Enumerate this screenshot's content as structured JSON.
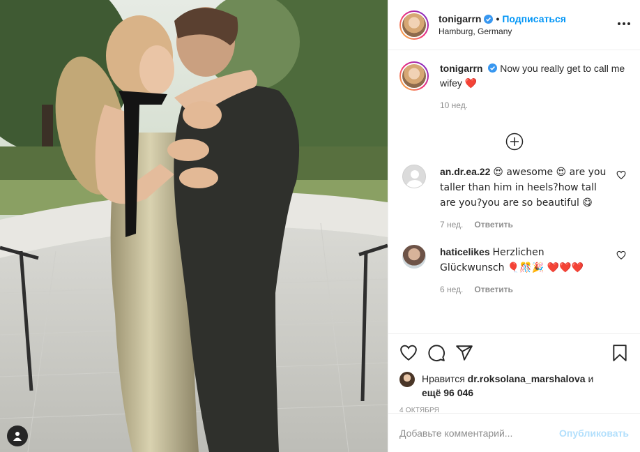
{
  "post": {
    "username": "tonigarrn",
    "follow_label": "Подписаться",
    "separator": "•",
    "location": "Hamburg, Germany",
    "more_icon": "more-horizontal-icon"
  },
  "caption": {
    "username": "tonigarrn",
    "text_line": "Now you really get to call me wifey",
    "emoji": "❤️",
    "age": "10 нед."
  },
  "load_more_icon": "plus-circle-icon",
  "comments": [
    {
      "username": "an.dr.ea.22",
      "text": "😍 awesome 😍 are you taller than him in heels?how tall are you?you are so beautiful 😋",
      "age": "7 нед.",
      "reply_label": "Ответить"
    },
    {
      "username": "haticelikes",
      "text": "Herzlichen Glückwunsch 🎈🎊🎉 ❤️❤️❤️",
      "age": "6 нед.",
      "reply_label": "Ответить"
    }
  ],
  "likes": {
    "prefix": "Нравится",
    "user": "dr.roksolana_marshalova",
    "and": "и",
    "more": "ещё 96 046"
  },
  "date": "4 ОКТЯБРЯ",
  "comment_box": {
    "placeholder": "Добавьте комментарий...",
    "publish_label": "Опубликовать"
  },
  "colors": {
    "accent": "#0095f6",
    "heart": "#ed4956",
    "muted": "#8e8e8e"
  }
}
